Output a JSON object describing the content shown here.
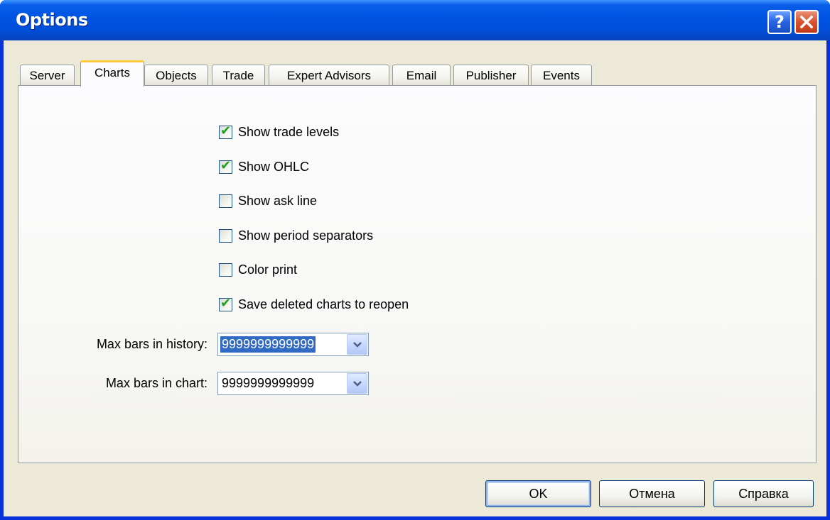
{
  "window": {
    "title": "Options",
    "help_label": "?",
    "close_icon": "close-x-icon"
  },
  "tabs": [
    {
      "label": "Server",
      "active": false
    },
    {
      "label": "Charts",
      "active": true
    },
    {
      "label": "Objects",
      "active": false
    },
    {
      "label": "Trade",
      "active": false
    },
    {
      "label": "Expert Advisors",
      "active": false
    },
    {
      "label": "Email",
      "active": false
    },
    {
      "label": "Publisher",
      "active": false
    },
    {
      "label": "Events",
      "active": false
    }
  ],
  "checkboxes": [
    {
      "label": "Show trade levels",
      "checked": true
    },
    {
      "label": "Show OHLC",
      "checked": true
    },
    {
      "label": "Show ask line",
      "checked": false
    },
    {
      "label": "Show period separators",
      "checked": false
    },
    {
      "label": "Color print",
      "checked": false
    },
    {
      "label": "Save deleted charts to reopen",
      "checked": true
    }
  ],
  "fields": {
    "max_bars_history": {
      "label": "Max bars in history:",
      "value": "9999999999999"
    },
    "max_bars_chart": {
      "label": "Max bars in chart:",
      "value": "9999999999999"
    }
  },
  "buttons": {
    "ok": "OK",
    "cancel": "Отмена",
    "help": "Справка"
  },
  "colors": {
    "titlebar": "#0054e3",
    "dialog_bg": "#ece9d8",
    "tab_highlight": "#ffc83c",
    "check_mark": "#21a121",
    "selection": "#316ac5"
  }
}
